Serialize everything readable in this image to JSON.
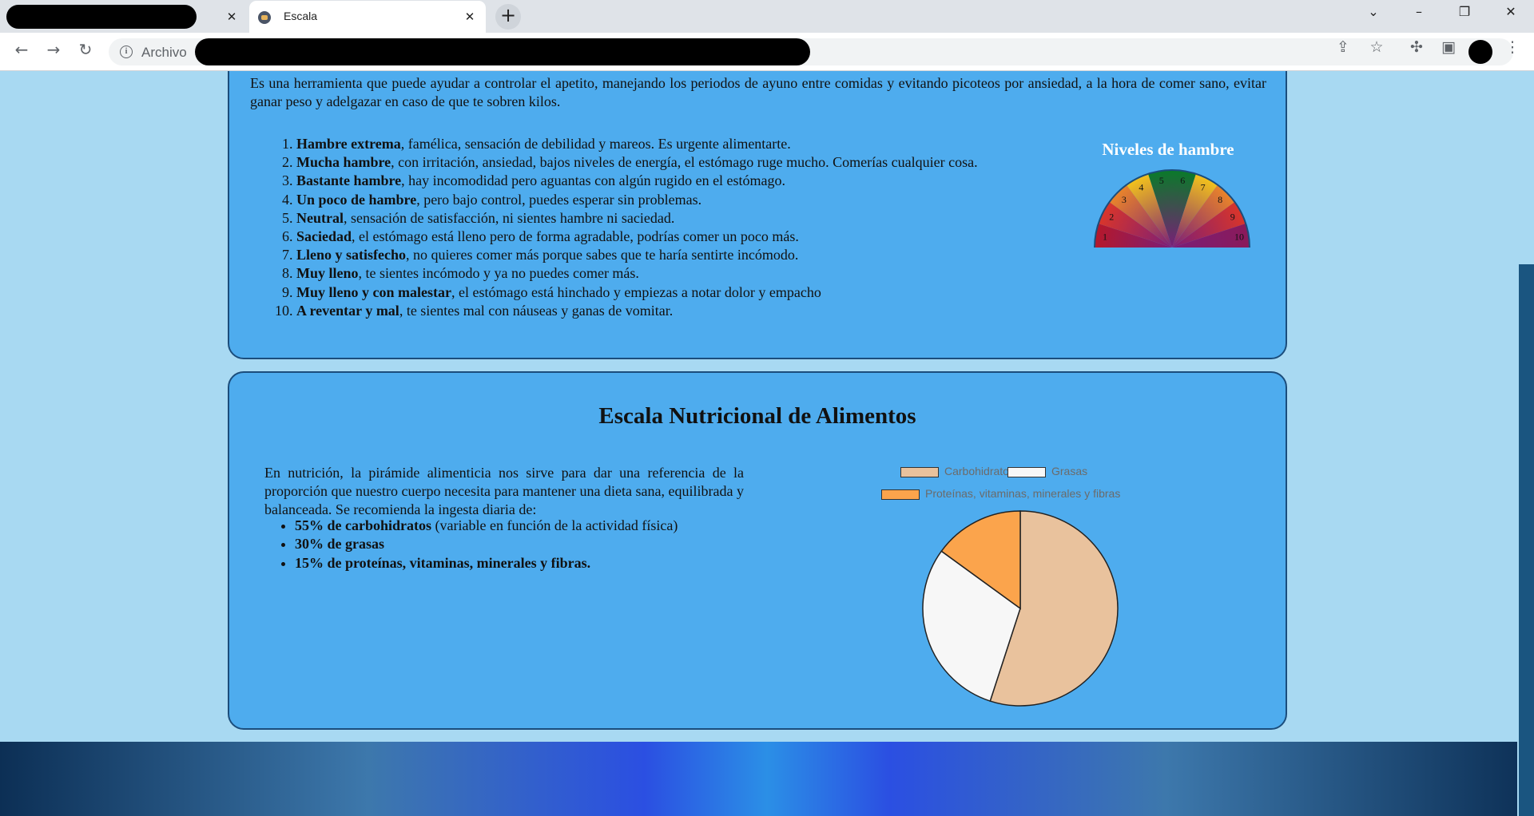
{
  "browser": {
    "active_tab_title": "Escala",
    "omnibox_label": "Archivo",
    "icons": [
      "close-icon",
      "new-tab-icon",
      "chevron-down-icon",
      "minimize-icon",
      "restore-icon",
      "window-close-icon",
      "back-icon",
      "forward-icon",
      "reload-icon",
      "info-icon",
      "share-icon",
      "star-icon",
      "extensions-icon",
      "sidebar-icon",
      "menu-icon"
    ]
  },
  "hunger": {
    "intro": "Es una herramienta que puede ayudar a controlar el apetito, manejando los periodos de ayuno entre comidas y evitando picoteos por ansiedad, a la hora de comer sano, evitar ganar peso y adelgazar en caso de que te sobren kilos.",
    "items": [
      {
        "bold": "Hambre extrema",
        "text": ", famélica, sensación de debilidad y mareos. Es urgente alimentarte."
      },
      {
        "bold": "Mucha hambre",
        "text": ", con irritación, ansiedad, bajos niveles de energía, el estómago ruge mucho. Comerías cualquier cosa."
      },
      {
        "bold": "Bastante hambre",
        "text": ", hay incomodidad pero aguantas con algún rugido en el estómago."
      },
      {
        "bold": "Un poco de hambre",
        "text": ", pero bajo control, puedes esperar sin problemas."
      },
      {
        "bold": "Neutral",
        "text": ", sensación de satisfacción, ni sientes hambre ni saciedad."
      },
      {
        "bold": "Saciedad",
        "text": ", el estómago está lleno pero de forma agradable, podrías comer un poco más."
      },
      {
        "bold": "Lleno y satisfecho",
        "text": ", no quieres comer más porque sabes que te haría sentirte incómodo."
      },
      {
        "bold": "Muy lleno",
        "text": ", te sientes incómodo y ya no puedes comer más."
      },
      {
        "bold": "Muy lleno y con malestar",
        "text": ", el estómago está hinchado y empiezas a notar dolor y empacho"
      },
      {
        "bold": "A reventar y mal",
        "text": ", te sientes mal con náuseas y ganas de vomitar."
      }
    ],
    "gauge_title": "Niveles de hambre",
    "gauge_labels": [
      "1",
      "2",
      "3",
      "4",
      "5",
      "6",
      "7",
      "8",
      "9",
      "10"
    ],
    "gauge_colors": [
      "#b5182b",
      "#d9352a",
      "#e9842a",
      "#f2c21c",
      "#0a7a2a",
      "#0a7a2a",
      "#f2c21c",
      "#e9842a",
      "#d9352a",
      "#8a1a5a"
    ]
  },
  "nutrition": {
    "title": "Escala Nutricional de Alimentos",
    "text": "En nutrición, la pirámide alimenticia nos sirve para dar una referencia de la proporción que nuestro cuerpo necesita para mantener una dieta sana, equilibrada y balanceada. Se recomienda la ingesta diaria de:",
    "items": [
      {
        "bold": "55% de carbohidratos",
        "text": " (variable en función de la actividad física)"
      },
      {
        "bold": "30% de grasas",
        "text": ""
      },
      {
        "bold": "15% de proteínas, vitaminas, minerales y fibras.",
        "text": ""
      }
    ]
  },
  "chart_data": {
    "type": "pie",
    "categories": [
      "Carbohidratos",
      "Grasas",
      "Proteínas, vitaminas, minerales y fibras"
    ],
    "values": [
      55,
      30,
      15
    ],
    "colors": [
      "#e9c29d",
      "#f7f7f7",
      "#fba44c"
    ],
    "legend": "top"
  }
}
